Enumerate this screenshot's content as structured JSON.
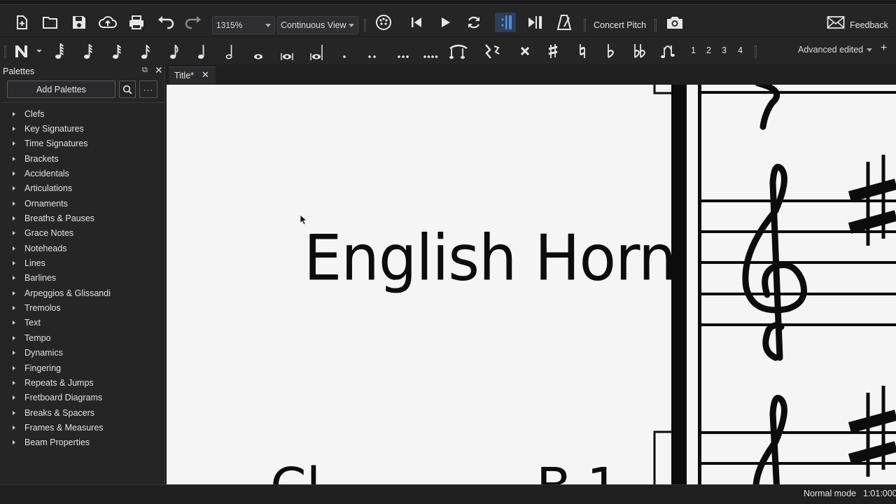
{
  "toolbar": {
    "zoom_value": "1315%",
    "view_mode": "Continuous View",
    "concert_pitch_label": "Concert Pitch",
    "feedback_label": "Feedback",
    "icons": [
      "new-score-icon",
      "open-icon",
      "save-icon",
      "cloud-upload-icon",
      "print-icon",
      "undo-icon",
      "redo-icon",
      "mixer-icon",
      "rewind-icon",
      "play-icon",
      "loop-icon",
      "playback-repeat-icon",
      "pan-score-icon",
      "metronome-icon",
      "screenshot-icon",
      "feedback-mail-icon"
    ]
  },
  "note_input": {
    "voices": [
      "1",
      "2",
      "3",
      "4"
    ],
    "workspace": "Advanced edited",
    "add_label": "+"
  },
  "palettes": {
    "header": "Palettes",
    "add_button": "Add Palettes",
    "more_label": "···",
    "items": [
      {
        "label": "Clefs"
      },
      {
        "label": "Key Signatures"
      },
      {
        "label": "Time Signatures"
      },
      {
        "label": "Brackets"
      },
      {
        "label": "Accidentals"
      },
      {
        "label": "Articulations"
      },
      {
        "label": "Ornaments"
      },
      {
        "label": "Breaths & Pauses"
      },
      {
        "label": "Grace Notes"
      },
      {
        "label": "Noteheads"
      },
      {
        "label": "Lines"
      },
      {
        "label": "Barlines"
      },
      {
        "label": "Arpeggios & Glissandi"
      },
      {
        "label": "Tremolos"
      },
      {
        "label": "Text"
      },
      {
        "label": "Tempo"
      },
      {
        "label": "Dynamics"
      },
      {
        "label": "Fingering"
      },
      {
        "label": "Repeats & Jumps"
      },
      {
        "label": "Fretboard Diagrams"
      },
      {
        "label": "Breaks & Spacers"
      },
      {
        "label": "Frames & Measures"
      },
      {
        "label": "Beam Properties"
      }
    ]
  },
  "tab": {
    "title": "Title*",
    "close_label": "✕"
  },
  "score": {
    "instrument_name": "English Horn"
  },
  "status": {
    "mode": "Normal mode",
    "position": "1:01:000"
  },
  "colors": {
    "toolbar_bg": "#252526",
    "canvas_bg": "#f5f5f5",
    "accent": "#4a90d9"
  }
}
